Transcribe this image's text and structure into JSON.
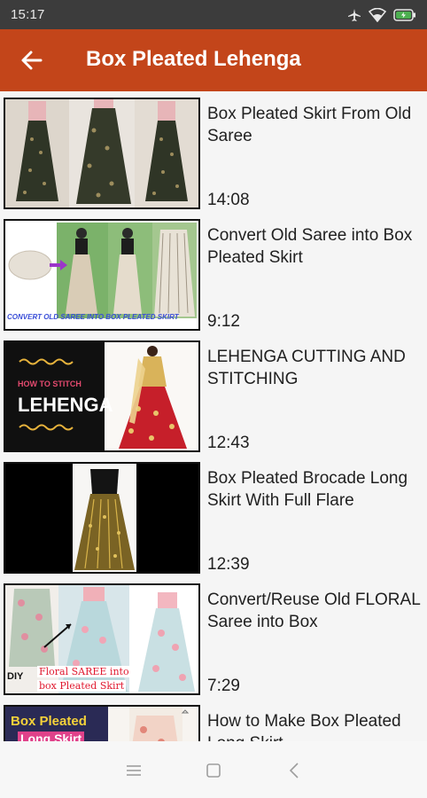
{
  "status_bar": {
    "time": "15:17",
    "icons": [
      "airplane-icon",
      "wifi-icon",
      "battery-charging-icon"
    ]
  },
  "app_bar": {
    "back_icon": "arrow-left-icon",
    "title": "Box Pleated Lehenga",
    "color": "#c3451a"
  },
  "videos": [
    {
      "title": "Box Pleated Skirt From Old Saree",
      "duration": "14:08"
    },
    {
      "title": "Convert Old Saree into Box Pleated Skirt",
      "duration": "9:12",
      "thumb_caption": "CONVERT OLD SAREE INTO BOX PLEATED SKIRT"
    },
    {
      "title": "LEHENGA CUTTING AND STITCHING",
      "duration": "12:43",
      "thumb_caption_1": "HOW TO STITCH",
      "thumb_caption_2": "LEHENGA"
    },
    {
      "title": "Box Pleated Brocade Long Skirt With Full Flare",
      "duration": "12:39"
    },
    {
      "title": "Convert/Reuse Old FLORAL Saree into Box",
      "duration": "7:29",
      "thumb_caption_1": "DIY",
      "thumb_caption_2": "Floral SAREE into",
      "thumb_caption_3": "box Pleated Skirt"
    },
    {
      "title": "How to Make Box Pleated Long Skirt",
      "duration": "",
      "thumb_caption_1": "Box Pleated",
      "thumb_caption_2": "Long Skirt"
    }
  ],
  "nav_bar": {
    "icons": [
      "menu-icon",
      "home-square-icon",
      "back-chevron-icon"
    ]
  }
}
